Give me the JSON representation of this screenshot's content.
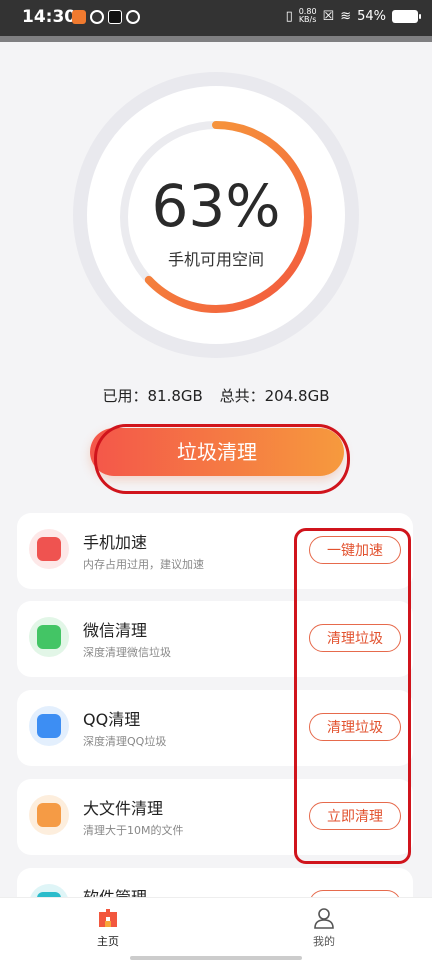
{
  "status_bar": {
    "time": "14:30",
    "net_speed_value": "0.80",
    "net_speed_unit": "KB/s",
    "battery": "54%"
  },
  "gauge": {
    "percent_text": "63%",
    "percent_value": 63,
    "label": "手机可用空间",
    "accent_start": "#f2573e",
    "accent_end": "#f7a63a"
  },
  "storage": {
    "used": "已用：81.8GB",
    "total": "总共：204.8GB"
  },
  "main_button": "垃圾清理",
  "features": [
    {
      "title": "手机加速",
      "subtitle": "内存占用过用，建议加速",
      "action": "一键加速",
      "icon": "rocket-icon",
      "icon_color": "#ef5350",
      "icon_bg": "#fde8e8"
    },
    {
      "title": "微信清理",
      "subtitle": "深度清理微信垃圾",
      "action": "清理垃圾",
      "icon": "wechat-icon",
      "icon_color": "#43c565",
      "icon_bg": "#e2f6e7"
    },
    {
      "title": "QQ清理",
      "subtitle": "深度清理QQ垃圾",
      "action": "清理垃圾",
      "icon": "qq-icon",
      "icon_color": "#3d8ef3",
      "icon_bg": "#e3effd"
    },
    {
      "title": "大文件清理",
      "subtitle": "清理大于10M的文件",
      "action": "立即清理",
      "icon": "folder-icon",
      "icon_color": "#f59b45",
      "icon_bg": "#fdeedd"
    },
    {
      "title": "软件管理",
      "subtitle": "",
      "action": "",
      "icon": "apps-icon",
      "icon_color": "#2bbccb",
      "icon_bg": "#dff5f7"
    }
  ],
  "bottom_nav": {
    "home": "主页",
    "me": "我的"
  }
}
